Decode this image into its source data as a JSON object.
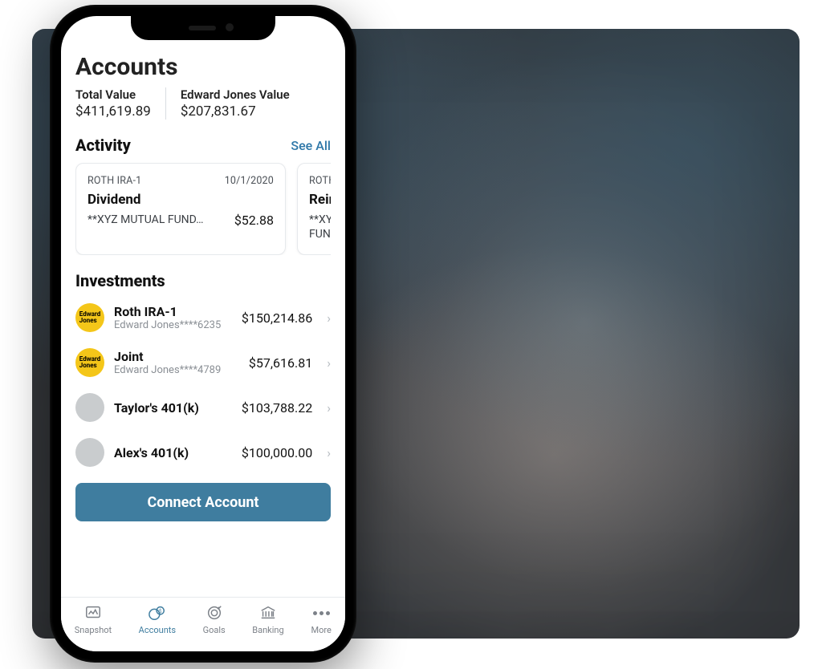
{
  "header": {
    "title": "Accounts"
  },
  "totals": {
    "total_label": "Total Value",
    "total_value": "$411,619.89",
    "ej_label": "Edward Jones Value",
    "ej_value": "$207,831.67"
  },
  "activity": {
    "title": "Activity",
    "see_all": "See All",
    "cards": [
      {
        "account": "ROTH IRA-1",
        "date": "10/1/2020",
        "title": "Dividend",
        "sub": "**XYZ MUTUAL FUND…",
        "amount": "$52.88"
      },
      {
        "account": "ROTH I",
        "date": "",
        "title": "Reinv",
        "sub": "**XYZ FUND",
        "amount": ""
      }
    ]
  },
  "investments": {
    "title": "Investments",
    "items": [
      {
        "badge": "ej",
        "name": "Roth IRA-1",
        "sub": "Edward Jones****6235",
        "amount": "$150,214.86"
      },
      {
        "badge": "ej",
        "name": "Joint",
        "sub": "Edward Jones****4789",
        "amount": "$57,616.81"
      },
      {
        "badge": "plain",
        "name": "Taylor's 401(k)",
        "sub": "",
        "amount": "$103,788.22"
      },
      {
        "badge": "plain",
        "name": "Alex's 401(k)",
        "sub": "",
        "amount": "$100,000.00"
      }
    ]
  },
  "cta": {
    "connect": "Connect Account"
  },
  "tabs": {
    "items": [
      {
        "label": "Snapshot"
      },
      {
        "label": "Accounts"
      },
      {
        "label": "Goals"
      },
      {
        "label": "Banking"
      },
      {
        "label": "More"
      }
    ],
    "active_index": 1
  },
  "brand": {
    "ej_line1": "Edward",
    "ej_line2": "Jones"
  }
}
